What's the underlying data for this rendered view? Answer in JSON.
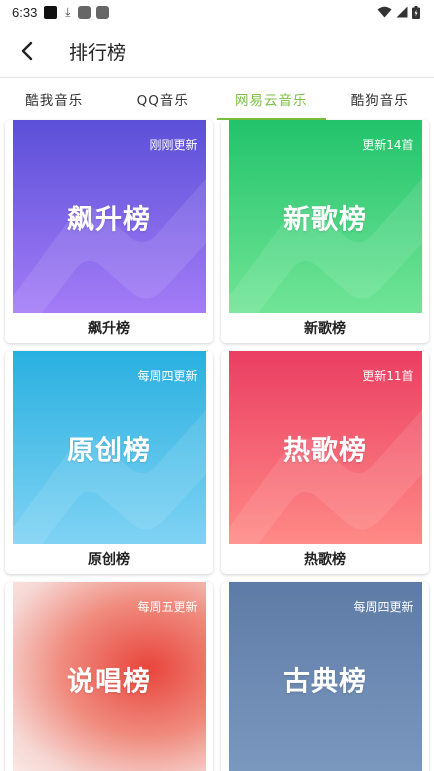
{
  "status_bar": {
    "time": "6:33",
    "download_glyph": "⤓"
  },
  "header": {
    "title": "排行榜",
    "back_icon": "chevron-left-icon"
  },
  "tabs": [
    {
      "label": "酷我音乐",
      "active": false
    },
    {
      "label": "QQ音乐",
      "active": false
    },
    {
      "label": "网易云音乐",
      "active": true
    },
    {
      "label": "酷狗音乐",
      "active": false
    }
  ],
  "accent_color": "#7cc042",
  "charts": [
    {
      "cover_name": "飙升榜",
      "update": "刚刚更新",
      "label": "飙升榜",
      "colors": [
        "#5b50d8",
        "#a47cf7"
      ]
    },
    {
      "cover_name": "新歌榜",
      "update": "更新14首",
      "label": "新歌榜",
      "colors": [
        "#22c36b",
        "#71e597"
      ]
    },
    {
      "cover_name": "原创榜",
      "update": "每周四更新",
      "label": "原创榜",
      "colors": [
        "#29b0e0",
        "#7fd3f4"
      ]
    },
    {
      "cover_name": "热歌榜",
      "update": "更新11首",
      "label": "热歌榜",
      "colors": [
        "#ea3e62",
        "#ff8a86"
      ]
    },
    {
      "cover_name": "说唱榜",
      "update": "每周五更新",
      "label": "",
      "colors": [
        "#e8453c",
        "#fbe9e6"
      ]
    },
    {
      "cover_name": "古典榜",
      "update": "每周四更新",
      "label": "",
      "colors": [
        "#5d7ba6",
        "#7b99bf"
      ]
    }
  ]
}
